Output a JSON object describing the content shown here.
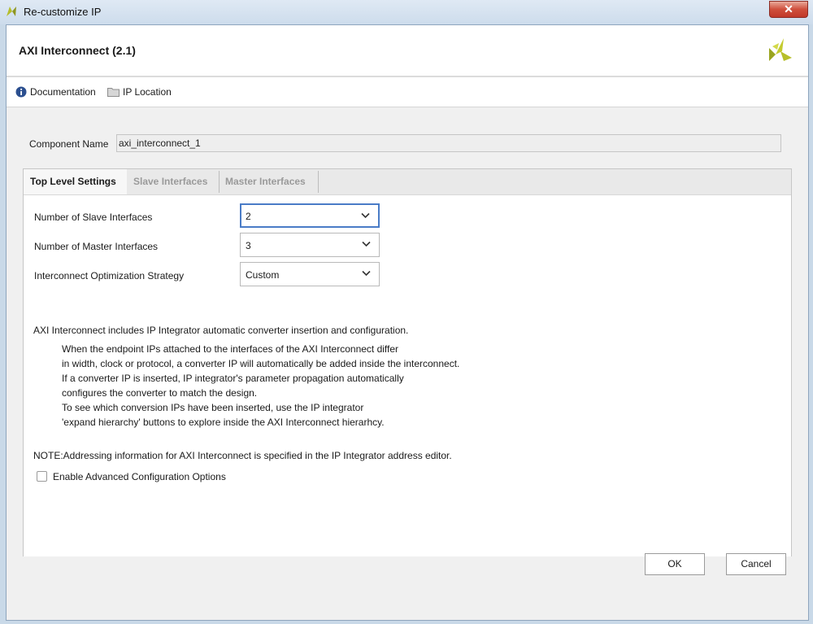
{
  "window": {
    "title": "Re-customize IP"
  },
  "header": {
    "title": "AXI Interconnect (2.1)"
  },
  "toolbar": {
    "documentation": "Documentation",
    "ip_location": "IP Location"
  },
  "component": {
    "label": "Component Name",
    "value": "axi_interconnect_1"
  },
  "tabs": [
    {
      "label": "Top Level Settings",
      "active": true
    },
    {
      "label": "Slave Interfaces",
      "active": false
    },
    {
      "label": "Master Interfaces",
      "active": false
    }
  ],
  "settings": [
    {
      "label": "Number of Slave Interfaces",
      "value": "2"
    },
    {
      "label": "Number of Master Interfaces",
      "value": "3"
    },
    {
      "label": "Interconnect Optimization Strategy",
      "value": "Custom"
    }
  ],
  "description": {
    "intro": "AXI Interconnect includes IP Integrator automatic converter insertion and configuration.",
    "lines": [
      "When the endpoint IPs attached to the interfaces of the AXI Interconnect differ",
      "in width, clock or protocol, a converter IP will automatically be added inside the interconnect.",
      "If a converter IP is inserted, IP integrator's parameter propagation automatically",
      "configures the converter to match the design.",
      "To see which conversion IPs have been inserted, use the IP integrator",
      "'expand hierarchy' buttons to explore inside the AXI Interconnect hierarhcy."
    ],
    "note": "NOTE:Addressing information for AXI Interconnect is specified in the IP Integrator address editor."
  },
  "advanced": {
    "label": "Enable Advanced Configuration Options",
    "checked": false
  },
  "buttons": {
    "ok": "OK",
    "cancel": "Cancel"
  },
  "colors": {
    "accent": "#4a7cc7",
    "logo": "#b5bd2a",
    "close": "#c1392a"
  },
  "icons": {
    "close": "close-icon",
    "info": "info-icon",
    "folder": "folder-icon",
    "chevron": "chevron-down-icon",
    "logo": "xilinx-logo-icon"
  }
}
